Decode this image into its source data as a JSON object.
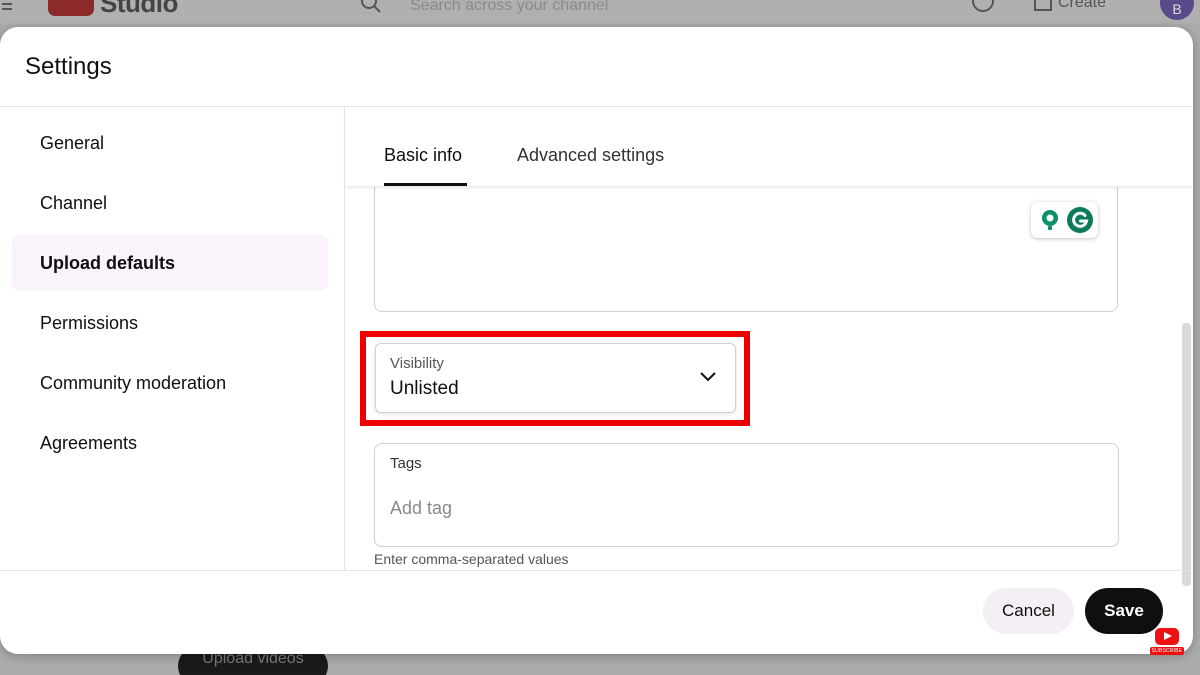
{
  "background": {
    "logo_text": "Studio",
    "search_placeholder": "Search across your channel",
    "create_label": "Create",
    "avatar_letter": "B",
    "upload_button_label": "Upload videos"
  },
  "dialog": {
    "title": "Settings",
    "sidebar": {
      "items": [
        {
          "label": "General",
          "active": false
        },
        {
          "label": "Channel",
          "active": false
        },
        {
          "label": "Upload defaults",
          "active": true
        },
        {
          "label": "Permissions",
          "active": false
        },
        {
          "label": "Community moderation",
          "active": false
        },
        {
          "label": "Agreements",
          "active": false
        }
      ]
    },
    "tabs": [
      {
        "label": "Basic info",
        "active": true
      },
      {
        "label": "Advanced settings",
        "active": false
      }
    ],
    "visibility": {
      "label": "Visibility",
      "value": "Unlisted"
    },
    "tags": {
      "label": "Tags",
      "placeholder": "Add tag",
      "hint": "Enter comma-separated values"
    },
    "footer": {
      "cancel_label": "Cancel",
      "save_label": "Save"
    }
  },
  "watermark": {
    "subscribe_text": "SUBSCRIBE"
  },
  "colors": {
    "highlight": "#ee0000",
    "save_button": "#0f0f0f",
    "active_nav_bg": "#fbf3fb",
    "grammarly_green": "#15c39a"
  }
}
